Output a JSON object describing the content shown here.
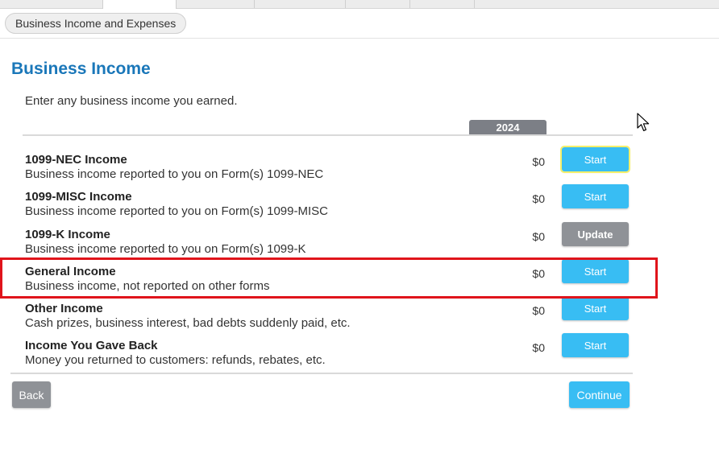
{
  "breadcrumb": {
    "label": "Business Income and Expenses"
  },
  "page": {
    "title": "Business Income",
    "intro": "Enter any business income you earned.",
    "year": "2024"
  },
  "rows": [
    {
      "label": "1099-NEC Income",
      "description": "Business income reported to you on Form(s) 1099-NEC",
      "amount": "$0",
      "button": "Start",
      "button_kind": "start"
    },
    {
      "label": "1099-MISC Income",
      "description": "Business income reported to you on Form(s) 1099-MISC",
      "amount": "$0",
      "button": "Start",
      "button_kind": "start"
    },
    {
      "label": "1099-K Income",
      "description": "Business income reported to you on Form(s) 1099-K",
      "amount": "$0",
      "button": "Update",
      "button_kind": "update"
    },
    {
      "label": "General Income",
      "description": "Business income, not reported on other forms",
      "amount": "$0",
      "button": "Start",
      "button_kind": "start"
    },
    {
      "label": "Other Income",
      "description": "Cash prizes, business interest, bad debts suddenly paid, etc.",
      "amount": "$0",
      "button": "Start",
      "button_kind": "start"
    },
    {
      "label": "Income You Gave Back",
      "description": "Money you returned to customers: refunds, rebates, etc.",
      "amount": "$0",
      "button": "Start",
      "button_kind": "start"
    }
  ],
  "footer": {
    "back_label": "Back",
    "continue_label": "Continue"
  },
  "colors": {
    "title": "#1a77b9",
    "start_button": "#38bdf3",
    "update_button": "#8f9297",
    "highlight_border": "#e0141b",
    "year_badge": "#7c7f86"
  },
  "icons": {
    "cursor": "mouse-pointer-icon"
  }
}
